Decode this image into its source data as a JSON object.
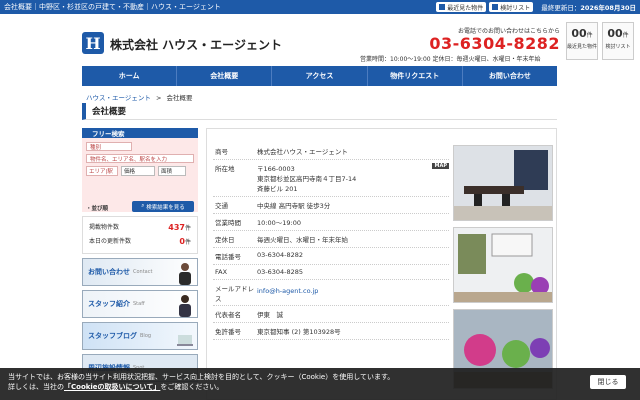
{
  "topbar": {
    "tagline": "会社概要｜中野区・杉並区の戸建て・不動産｜ハウス・エージェント",
    "recent_label": "最近見た物件",
    "consider_label": "検討リスト",
    "date_label": "最終更新日：",
    "date_value": "2026年08月30日"
  },
  "header": {
    "logo_mark": "H",
    "company": "株式会社 ハウス・エージェント",
    "contact_lead": "お電話でのお問い合わせはこちらから",
    "tel": "03-6304-8282",
    "hours": "営業時間：10:00〜19:00 定休日：毎週火曜日、水曜日・年末年始",
    "counters": [
      {
        "num": "00",
        "unit": "件",
        "label": "最近見た物件"
      },
      {
        "num": "00",
        "unit": "件",
        "label": "検討リスト"
      }
    ]
  },
  "nav": [
    "ホーム",
    "会社概要",
    "アクセス",
    "物件リクエスト",
    "お問い合わせ"
  ],
  "breadcrumb": {
    "home": "ハウス・エージェント",
    "sep": ">",
    "current": "会社概要"
  },
  "page_title": "会社概要",
  "sidebar": {
    "search_title": "フリー検索",
    "type_placeholder": "種別",
    "keyword_placeholder": "物件名、エリア名、駅名を入力",
    "area_label": "エリア|駅",
    "price_label": "価格",
    "layout_label": "面積",
    "sort_label": "・並び順",
    "search_button": "検索結果を見る",
    "stats": [
      {
        "label": "掲載物件数",
        "value": "437",
        "unit": "件"
      },
      {
        "label": "本日の更新件数",
        "value": "0",
        "unit": "件"
      }
    ],
    "banners": [
      {
        "title": "お問い合わせ",
        "sub": "Contact"
      },
      {
        "title": "スタッフ紹介",
        "sub": "Staff"
      },
      {
        "title": "スタッフブログ",
        "sub": "Blog"
      },
      {
        "title": "周辺施設情報",
        "sub": "Spot"
      }
    ]
  },
  "company_info": [
    {
      "key": "商号",
      "value": "株式会社ハウス・エージェント"
    },
    {
      "key": "所在地",
      "value": "〒166-0003\n東京都杉並区高円寺南４丁目7-14\n斉藤ビル 201",
      "badge": "MAP"
    },
    {
      "key": "交通",
      "value": "中央線 高円寺駅 徒歩3分"
    },
    {
      "key": "営業時間",
      "value": "10:00〜19:00"
    },
    {
      "key": "定休日",
      "value": "毎週火曜日、水曜日・年末年始"
    },
    {
      "key": "電話番号",
      "value": "03-6304-8282"
    },
    {
      "key": "FAX",
      "value": "03-6304-8285"
    },
    {
      "key": "メールアドレス",
      "value": "info@h-agent.co.jp",
      "link": true
    },
    {
      "key": "代表者名",
      "value": "伊東　誠"
    },
    {
      "key": "免許番号",
      "value": "東京都知事 (2) 第103928号"
    }
  ],
  "cookie": {
    "line1": "当サイトでは、お客様の当サイト利用状況把握、サービス向上検討を目的として、クッキー（Cookie）を使用しています。",
    "line2_pre": "詳しくは、当社の",
    "link": "「Cookieの取扱いについて」",
    "line2_post": "をご確認ください。",
    "close": "閉じる"
  }
}
